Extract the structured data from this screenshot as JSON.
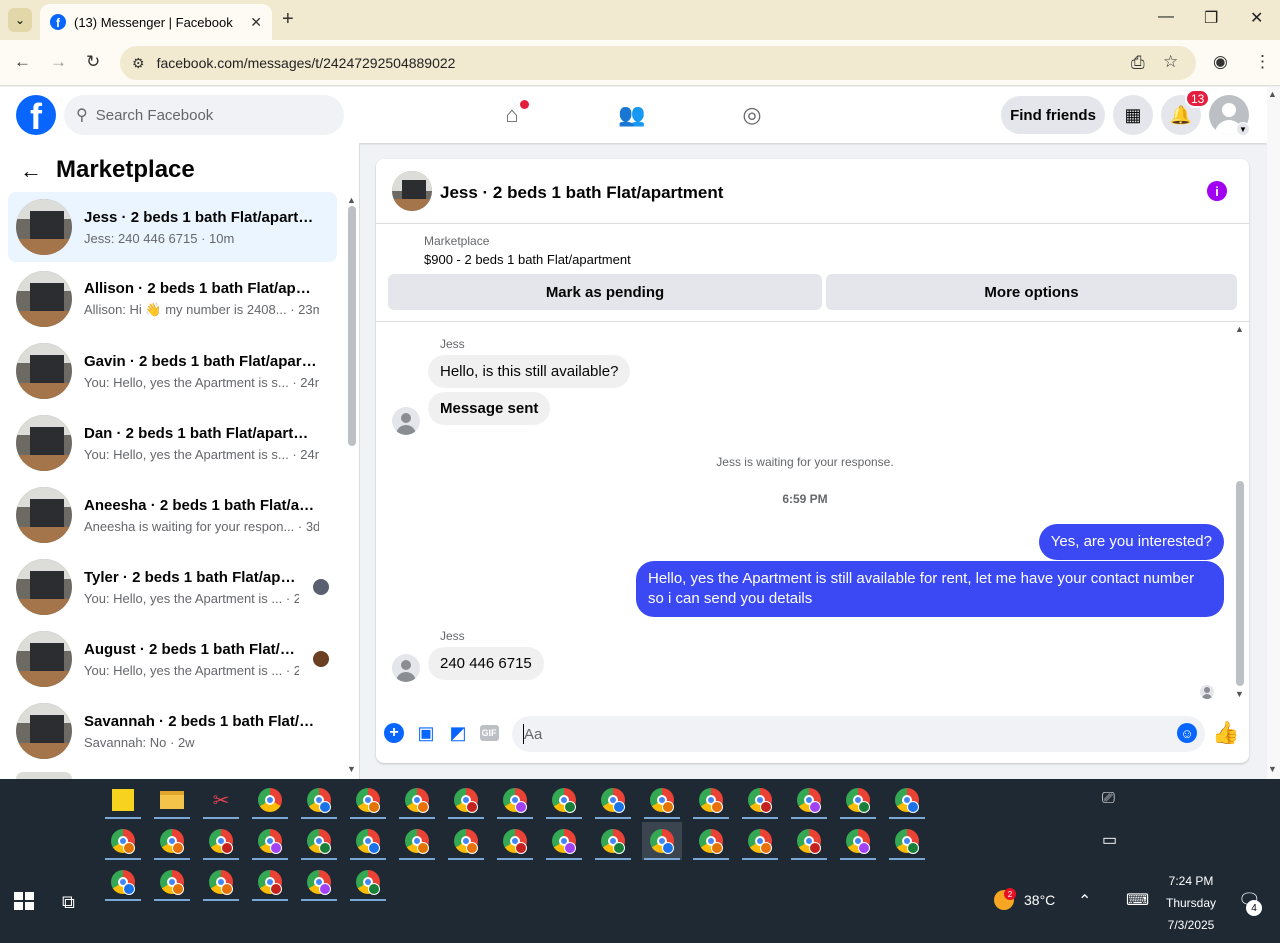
{
  "browser": {
    "tab_title": "(13) Messenger | Facebook",
    "favicon_letter": "f",
    "url": "facebook.com/messages/t/24247292504889022",
    "new_tab_glyph": "+",
    "close_glyph": "✕"
  },
  "fb_header": {
    "logo_letter": "f",
    "search_placeholder": "Search Facebook",
    "find_friends": "Find friends",
    "notifications_count": "13",
    "home_has_unread": true
  },
  "sidebar": {
    "title": "Marketplace",
    "conversations": [
      {
        "name": "Jess · 2 beds 1 bath Flat/apartm...",
        "snippet": "Jess: 240 446 6715 · 10m",
        "active": true
      },
      {
        "name": "Allison · 2 beds 1 bath Flat/apart...",
        "snippet": "Allison: Hi 👋 my number is 2408... · 23m",
        "active": false
      },
      {
        "name": "Gavin · 2 beds 1 bath Flat/apart...",
        "snippet": "You: Hello, yes the Apartment is s... · 24m",
        "active": false
      },
      {
        "name": "Dan · 2 beds 1 bath Flat/apartm...",
        "snippet": "You: Hello, yes the Apartment is s... · 24m",
        "active": false
      },
      {
        "name": "Aneesha · 2 beds 1 bath Flat/apa...",
        "snippet": "Aneesha is waiting for your respon... · 3d",
        "active": false
      },
      {
        "name": "Tyler · 2 beds 1 bath Flat/apar...",
        "snippet": "You: Hello, yes the Apartment is ... · 2w",
        "active": false
      },
      {
        "name": "August · 2 beds 1 bath Flat/ap...",
        "snippet": "You: Hello, yes the Apartment is ... · 2w",
        "active": false
      },
      {
        "name": "Savannah · 2 beds 1 bath Flat/ap...",
        "snippet": "Savannah: No · 2w",
        "active": false
      }
    ]
  },
  "chat": {
    "title": "Jess · 2 beds 1 bath Flat/apartment",
    "info_glyph": "i",
    "listing_label": "Marketplace",
    "listing_title": "$900 - 2 beds 1 bath Flat/apartment",
    "mark_pending": "Mark as pending",
    "more_options": "More options",
    "messages": {
      "sender1": "Jess",
      "in1": "Hello, is this still available?",
      "in2": "Message sent",
      "system": "Jess is waiting for your response.",
      "time": "6:59 PM",
      "out1": "Yes, are you interested?",
      "out2": "Hello, yes the Apartment is still available for rent, let me have your contact number so i can send you details",
      "sender2": "Jess",
      "in3": "240 446 6715"
    },
    "composer_placeholder": "Aa",
    "gif_label": "GIF"
  },
  "taskbar": {
    "temperature": "38°C",
    "weather_badge": "2",
    "time": "7:24 PM",
    "day": "Thursday",
    "date": "7/3/2025",
    "notification_count": "4"
  }
}
